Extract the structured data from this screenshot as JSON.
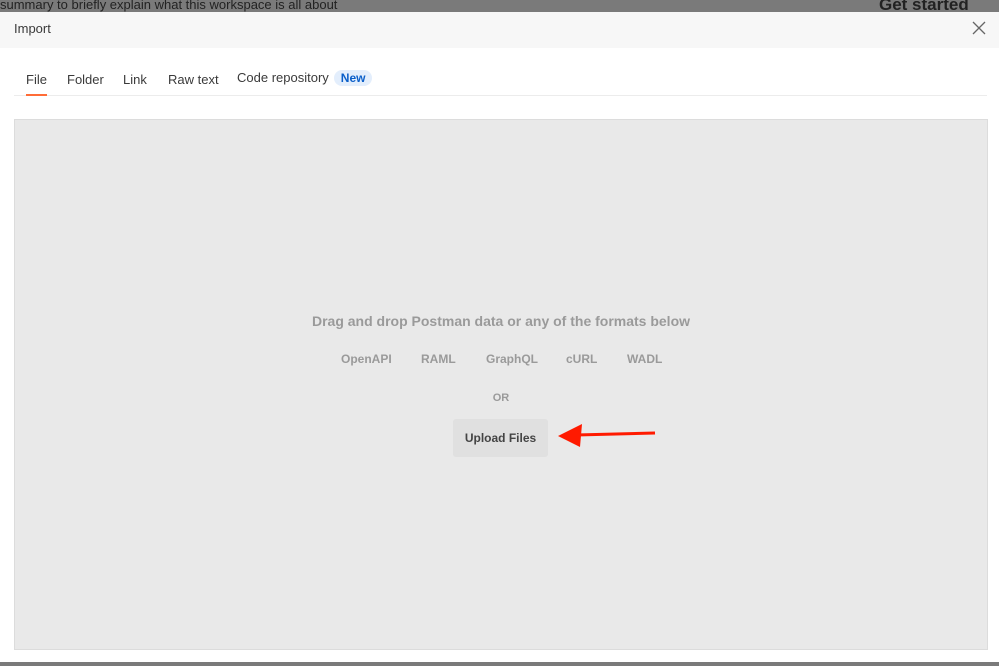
{
  "background": {
    "text": "summary to briefly explain what this workspace is all about",
    "heading": "Get started"
  },
  "modal": {
    "title": "Import",
    "tabs": [
      {
        "label": "File",
        "active": true
      },
      {
        "label": "Folder"
      },
      {
        "label": "Link"
      },
      {
        "label": "Raw text"
      },
      {
        "label": "Code repository",
        "badge": "New"
      }
    ],
    "dropzone": {
      "message": "Drag and drop Postman data or any of the formats below",
      "formats": [
        "OpenAPI",
        "RAML",
        "GraphQL",
        "cURL",
        "WADL"
      ],
      "or": "OR",
      "upload_label": "Upload Files"
    }
  },
  "colors": {
    "accent": "#ff6c37",
    "badge": "#0b5fc9",
    "annotation_arrow": "#ff1a00"
  }
}
